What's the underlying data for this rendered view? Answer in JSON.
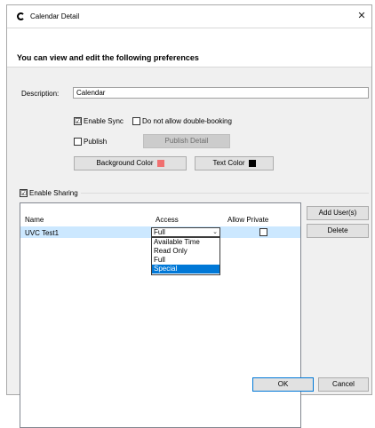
{
  "window": {
    "title": "Calendar Detail",
    "close_glyph": "✕"
  },
  "header": {
    "text": "You can view and edit the following preferences"
  },
  "description": {
    "label": "Description:",
    "value": "Calendar"
  },
  "options": {
    "enable_sync": {
      "label": "Enable Sync",
      "checked": true
    },
    "no_double_booking": {
      "label": "Do not allow double-booking",
      "checked": false
    },
    "publish": {
      "label": "Publish",
      "checked": false
    },
    "publish_detail_label": "Publish Detail"
  },
  "colors": {
    "background_label": "Background Color",
    "background_swatch": "#f07070",
    "text_label": "Text Color",
    "text_swatch": "#000000"
  },
  "sharing": {
    "label": "Enable Sharing",
    "checked": true,
    "columns": {
      "name": "Name",
      "access": "Access",
      "allow_private": "Allow Private"
    },
    "rows": [
      {
        "name": "UVC Test1",
        "access": "Full",
        "allow_private": false
      }
    ],
    "access_options": [
      "Available Time",
      "Read Only",
      "Full",
      "Special"
    ],
    "highlighted_option": "Special",
    "add_user_label": "Add User(s)",
    "delete_label": "Delete"
  },
  "footer": {
    "ok_label": "OK",
    "cancel_label": "Cancel"
  },
  "icons": {
    "check": "☑",
    "dropdown": "⌄"
  }
}
